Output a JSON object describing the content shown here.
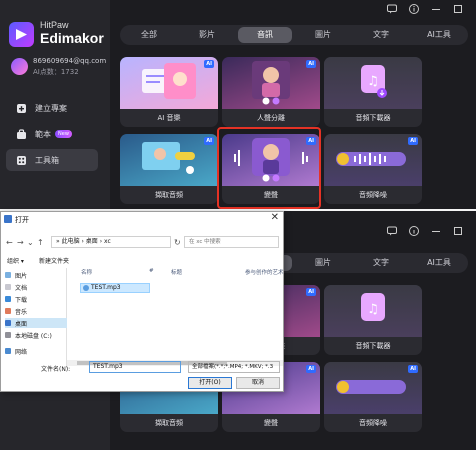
{
  "app": {
    "brand_small": "HitPaw",
    "brand_name": "Edimakor",
    "user_email": "869609694@qq.com",
    "user_credits": "AI点数：1732"
  },
  "sidebar": {
    "items": [
      {
        "label": "建立專案",
        "icon": "new-project-icon"
      },
      {
        "label": "範本",
        "icon": "template-icon",
        "badge": "New"
      },
      {
        "label": "工具箱",
        "icon": "toolbox-icon"
      }
    ]
  },
  "tabs": [
    "全部",
    "影片",
    "音訊",
    "圖片",
    "文字",
    "AI工具"
  ],
  "active_tab": "音訊",
  "cards": [
    {
      "label": "AI 音樂",
      "ai": "AI"
    },
    {
      "label": "人聲分離",
      "ai": "AI"
    },
    {
      "label": "音頻下載器",
      "ai": ""
    },
    {
      "label": "擷取音頻",
      "ai": "AI"
    },
    {
      "label": "變聲",
      "ai": "AI"
    },
    {
      "label": "音頻降噪",
      "ai": "AI"
    }
  ],
  "dialog": {
    "title": "打开",
    "close": "✕",
    "path": "» 此电脑 › 桌面 › xc",
    "search_placeholder": "在 xc 中搜索",
    "organize": "组织 ▾",
    "new_folder": "新建文件夹",
    "side_items": [
      "图片",
      "文档",
      "下载",
      "音乐",
      "桌面",
      "本地磁盘 (C:)",
      "网络"
    ],
    "col_name": "名称",
    "col_num": "#",
    "col_title": "标题",
    "col_artist": "参与创作的艺术",
    "file": "TEST.mp3",
    "filename_label": "文件名(N):",
    "filename_value": "TEST.mp3",
    "filetype_value": "全部檔案(*.*;*.MP4; *.MKV; *.3",
    "open_btn": "打开(O)",
    "cancel_btn": "取消"
  },
  "colors": {
    "accent": "#2f6bff",
    "highlight": "#e53225",
    "bg": "#1c1c20"
  }
}
